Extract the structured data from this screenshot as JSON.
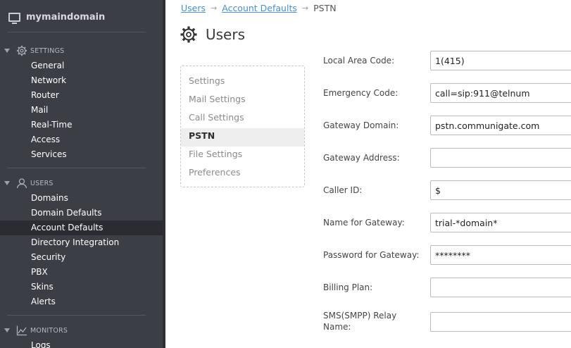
{
  "sidebar": {
    "brand": "mymaindomain",
    "sections": [
      {
        "label": "SETTINGS",
        "icon": "gear-icon"
      },
      {
        "label": "USERS",
        "icon": "user-icon"
      },
      {
        "label": "MONITORS",
        "icon": "chart-icon"
      }
    ],
    "settings_items": [
      "General",
      "Network",
      "Router",
      "Mail",
      "Real-Time",
      "Access",
      "Services"
    ],
    "users_items": [
      "Domains",
      "Domain Defaults",
      "Account Defaults",
      "Directory Integration",
      "Security",
      "PBX",
      "Skins",
      "Alerts"
    ],
    "monitors_items": [
      "Logs"
    ],
    "active_item": "Account Defaults"
  },
  "breadcrumb": {
    "items": [
      "Users",
      "Account Defaults",
      "PSTN"
    ]
  },
  "page": {
    "title": "Users"
  },
  "submenu": {
    "items": [
      "Settings",
      "Mail Settings",
      "Call Settings",
      "PSTN",
      "File Settings",
      "Preferences"
    ],
    "active": "PSTN"
  },
  "form": {
    "fields": [
      {
        "label": "Local Area Code:",
        "value": "1(415)"
      },
      {
        "label": "Emergency Code:",
        "value": "call=sip:911@telnum"
      },
      {
        "label": "Gateway Domain:",
        "value": "pstn.communigate.com"
      },
      {
        "label": "Gateway Address:",
        "value": ""
      },
      {
        "label": "Caller ID:",
        "value": "$"
      },
      {
        "label": "Name for Gateway:",
        "value": "trial-*domain*"
      },
      {
        "label": "Password for Gateway:",
        "value": "********"
      },
      {
        "label": "Billing Plan:",
        "value": ""
      },
      {
        "label": "SMS(SMPP) Relay Name:",
        "value": ""
      }
    ]
  }
}
